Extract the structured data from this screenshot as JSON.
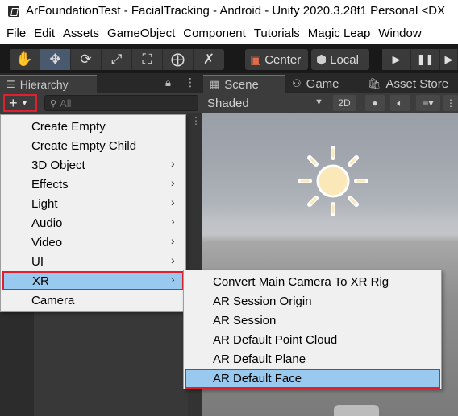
{
  "window": {
    "title": "ArFoundationTest - FacialTracking - Android - Unity 2020.3.28f1 Personal <DX"
  },
  "menubar": [
    "File",
    "Edit",
    "Assets",
    "GameObject",
    "Component",
    "Tutorials",
    "Magic Leap",
    "Window"
  ],
  "toolbar": {
    "tools": [
      "hand-tool-icon",
      "move-tool-icon",
      "rotate-tool-icon",
      "scale-tool-icon",
      "rect-tool-icon",
      "transform-tool-icon",
      "custom-tool-icon"
    ],
    "pivot_label": "Center",
    "space_label": "Local"
  },
  "hierarchy": {
    "tab_label": "Hierarchy",
    "add_glyph": "+",
    "search_placeholder": "All"
  },
  "scene": {
    "tabs": [
      "Scene",
      "Game",
      "Asset Store"
    ],
    "shading_mode": "Shaded",
    "mode_2d": "2D"
  },
  "create_menu": {
    "items": [
      {
        "label": "Create Empty",
        "submenu": false
      },
      {
        "label": "Create Empty Child",
        "submenu": false
      },
      {
        "label": "3D Object",
        "submenu": true
      },
      {
        "label": "Effects",
        "submenu": true
      },
      {
        "label": "Light",
        "submenu": true
      },
      {
        "label": "Audio",
        "submenu": true
      },
      {
        "label": "Video",
        "submenu": true
      },
      {
        "label": "UI",
        "submenu": true
      },
      {
        "label": "XR",
        "submenu": true,
        "selected": true
      },
      {
        "label": "Camera",
        "submenu": false
      }
    ]
  },
  "xr_submenu": {
    "items": [
      {
        "label": "Convert Main Camera To XR Rig"
      },
      {
        "label": "AR Session Origin"
      },
      {
        "label": "AR Session"
      },
      {
        "label": "AR Default Point Cloud"
      },
      {
        "label": "AR Default Plane"
      },
      {
        "label": "AR Default Face",
        "selected": true
      }
    ]
  },
  "colors": {
    "highlight": "#99c9ef",
    "annotation_red": "#e0202e",
    "tab_accent": "#3a79bb"
  }
}
